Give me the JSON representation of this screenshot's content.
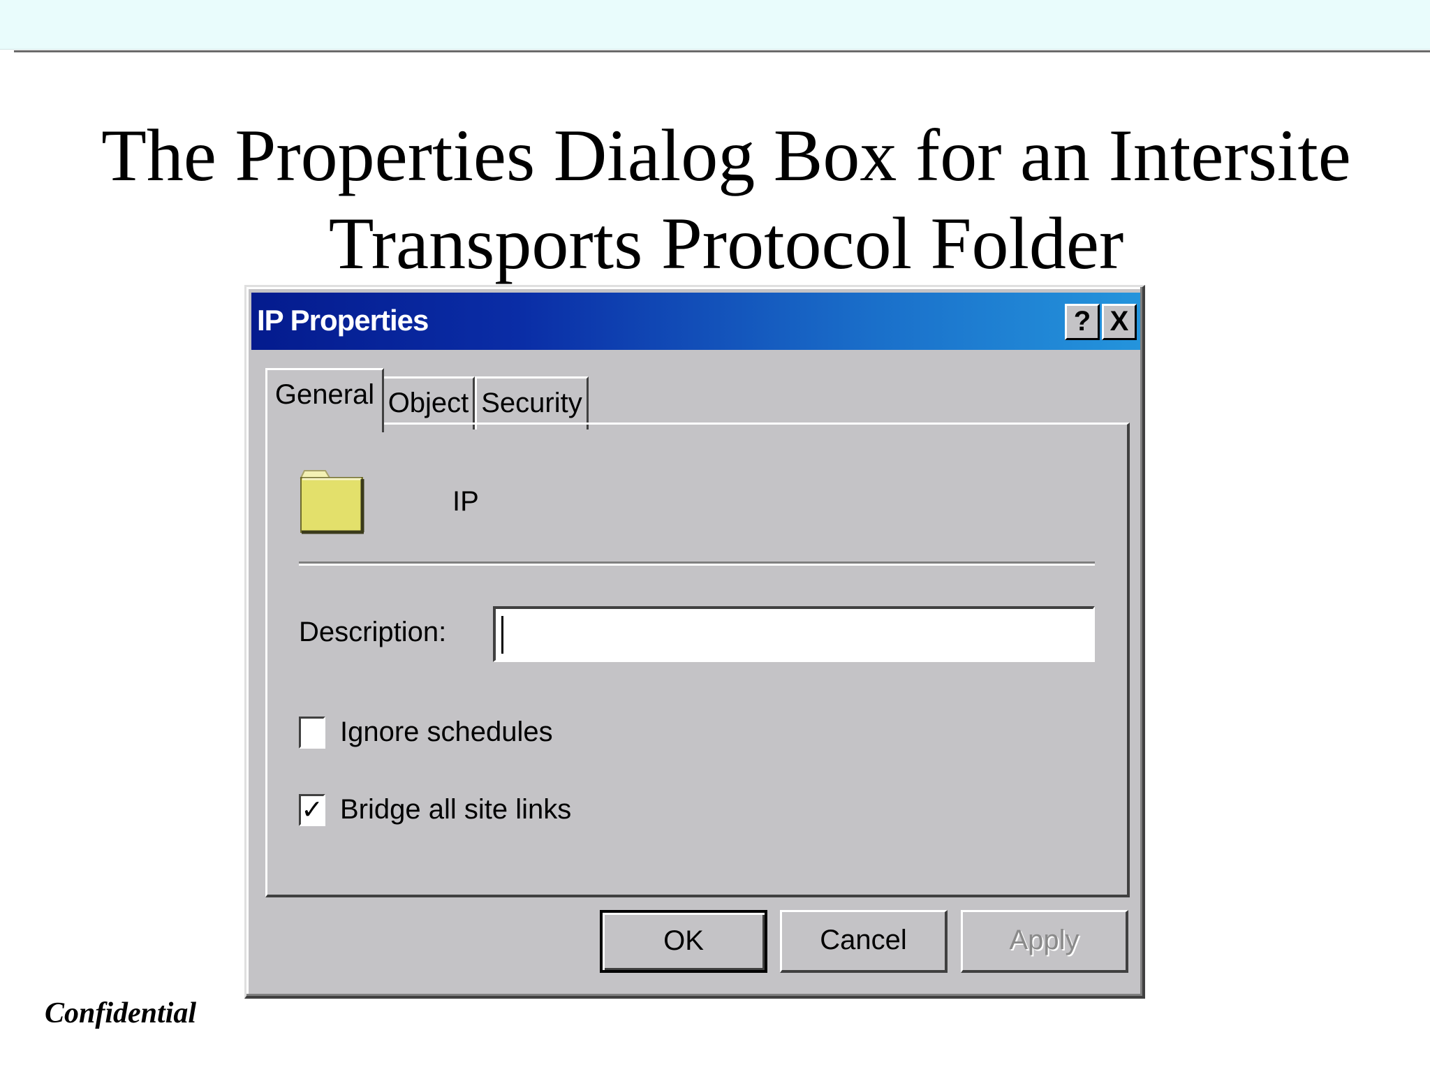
{
  "slide": {
    "title_line1": "The Properties Dialog Box for an Intersite",
    "title_line2": "Transports Protocol Folder",
    "footer": "Confidential"
  },
  "dialog": {
    "title": "IP Properties",
    "help_button": "?",
    "close_button": "X",
    "tabs": [
      {
        "label": "General",
        "selected": true
      },
      {
        "label": "Object",
        "selected": false
      },
      {
        "label": "Security",
        "selected": false
      }
    ],
    "general": {
      "icon": "folder-icon",
      "object_name": "IP",
      "description_label": "Description:",
      "description_value": "",
      "checkboxes": [
        {
          "label": "Ignore schedules",
          "checked": false,
          "mark": ""
        },
        {
          "label": "Bridge all site links",
          "checked": true,
          "mark": "✓"
        }
      ]
    },
    "buttons": {
      "ok": "OK",
      "cancel": "Cancel",
      "apply": "Apply"
    }
  },
  "colors": {
    "dialog_face": "#c4c3c6",
    "titlebar_start": "#041b8e",
    "titlebar_end": "#2494dc",
    "folder": "#e3e06b",
    "top_band": "#e9fcfc"
  }
}
